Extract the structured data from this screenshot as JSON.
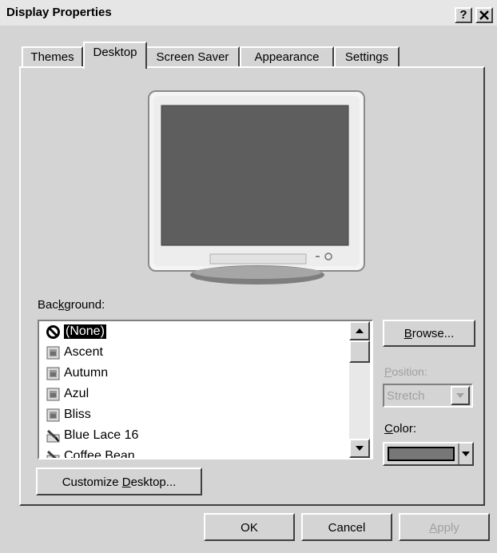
{
  "window": {
    "title": "Display Properties",
    "help_label": "?",
    "close_label": "✕"
  },
  "tabs": [
    {
      "label": "Themes"
    },
    {
      "label": "Desktop"
    },
    {
      "label": "Screen Saver"
    },
    {
      "label": "Appearance"
    },
    {
      "label": "Settings"
    }
  ],
  "background": {
    "label_pre": "Bac",
    "label_key": "k",
    "label_post": "ground:",
    "items": [
      {
        "label": "(None)",
        "icon": "none-icon",
        "selected": true
      },
      {
        "label": "Ascent",
        "icon": "image-file-icon"
      },
      {
        "label": "Autumn",
        "icon": "image-file-icon"
      },
      {
        "label": "Azul",
        "icon": "image-file-icon"
      },
      {
        "label": "Bliss",
        "icon": "image-file-icon"
      },
      {
        "label": "Blue Lace 16",
        "icon": "paint-file-icon"
      },
      {
        "label": "Coffee Bean",
        "icon": "paint-file-icon"
      }
    ]
  },
  "browse": {
    "key": "B",
    "rest": "rowse..."
  },
  "position": {
    "key": "P",
    "rest": "osition:",
    "value": "Stretch"
  },
  "color": {
    "key": "C",
    "rest": "olor:",
    "swatch": "#777777"
  },
  "customize": {
    "pre": "Customize ",
    "key": "D",
    "post": "esktop..."
  },
  "footer": {
    "ok": "OK",
    "cancel": "Cancel",
    "apply_key": "A",
    "apply_rest": "pply"
  }
}
